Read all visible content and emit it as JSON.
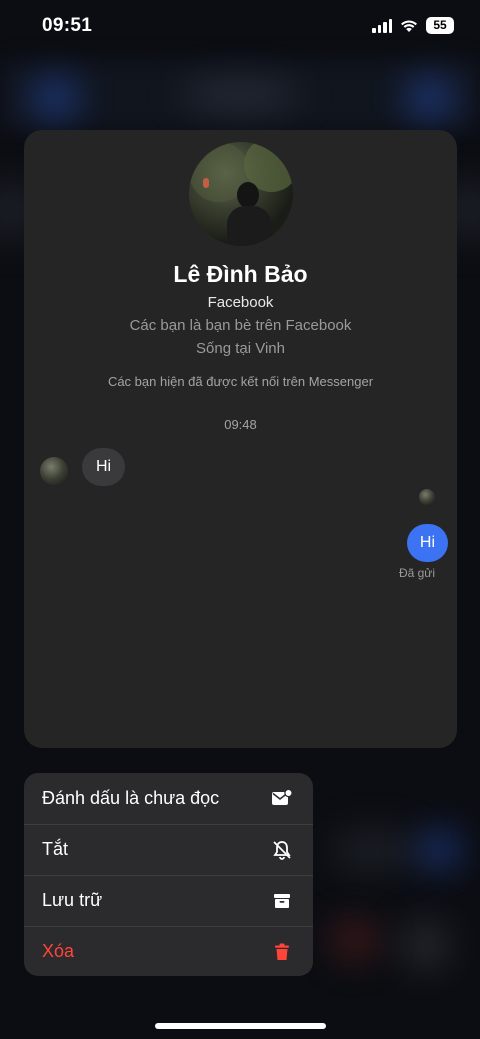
{
  "status_bar": {
    "time": "09:51",
    "battery": "55"
  },
  "profile": {
    "name": "Lê Đình Bảo",
    "source": "Facebook",
    "friend_status": "Các bạn là bạn bè trên Facebook",
    "location": "Sống tại Vinh",
    "connected_note": "Các bạn hiện đã được kết nối trên Messenger"
  },
  "chat": {
    "timestamp": "09:48",
    "incoming_message": "Hi",
    "outgoing_message": "Hi",
    "sent_status": "Đã gửi"
  },
  "context_menu": {
    "items": [
      {
        "label": "Đánh dấu là chưa đọc",
        "icon": "mark-unread-icon"
      },
      {
        "label": "Tắt",
        "icon": "bell-slash-icon"
      },
      {
        "label": "Lưu trữ",
        "icon": "archive-icon"
      },
      {
        "label": "Xóa",
        "icon": "trash-icon",
        "destructive": true
      }
    ]
  },
  "colors": {
    "outgoing_bubble": "#3b73f3",
    "destructive": "#ff453a",
    "card_background": "#252525"
  }
}
